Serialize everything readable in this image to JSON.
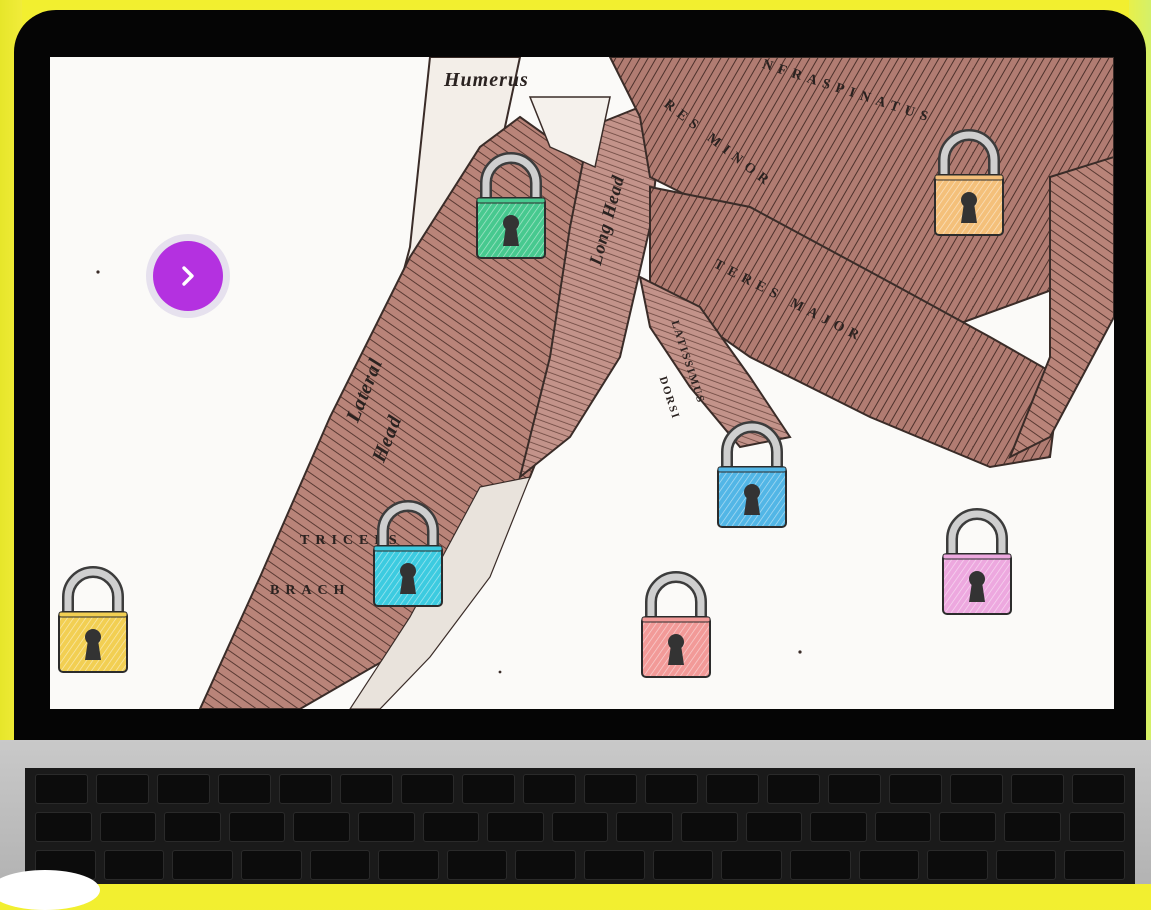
{
  "labels": {
    "humerus": "Humerus",
    "teres_minor": "RES MINOR",
    "infraspinatus": "NFRASPINATUS",
    "long_head": "Long Head",
    "teres_major": "TERES MAJOR",
    "latissimus": "LATISSIMUS",
    "dorsi": "DORSI",
    "lateral_head_1": "Lateral",
    "lateral_head_2": "Head",
    "triceps": "TRICEPS",
    "brachii": "BRACH"
  },
  "nav_button": {
    "icon": "chevron-right-icon",
    "color": "#b431e0"
  },
  "locks": [
    {
      "name": "lock-green",
      "color": "#47c98f"
    },
    {
      "name": "lock-orange",
      "color": "#f4c07a"
    },
    {
      "name": "lock-blue",
      "color": "#52b6e6"
    },
    {
      "name": "lock-cyan",
      "color": "#3ccbe0"
    },
    {
      "name": "lock-pink",
      "color": "#eda8df"
    },
    {
      "name": "lock-red",
      "color": "#f29a98"
    },
    {
      "name": "lock-yellow",
      "color": "#f2cf52"
    }
  ]
}
